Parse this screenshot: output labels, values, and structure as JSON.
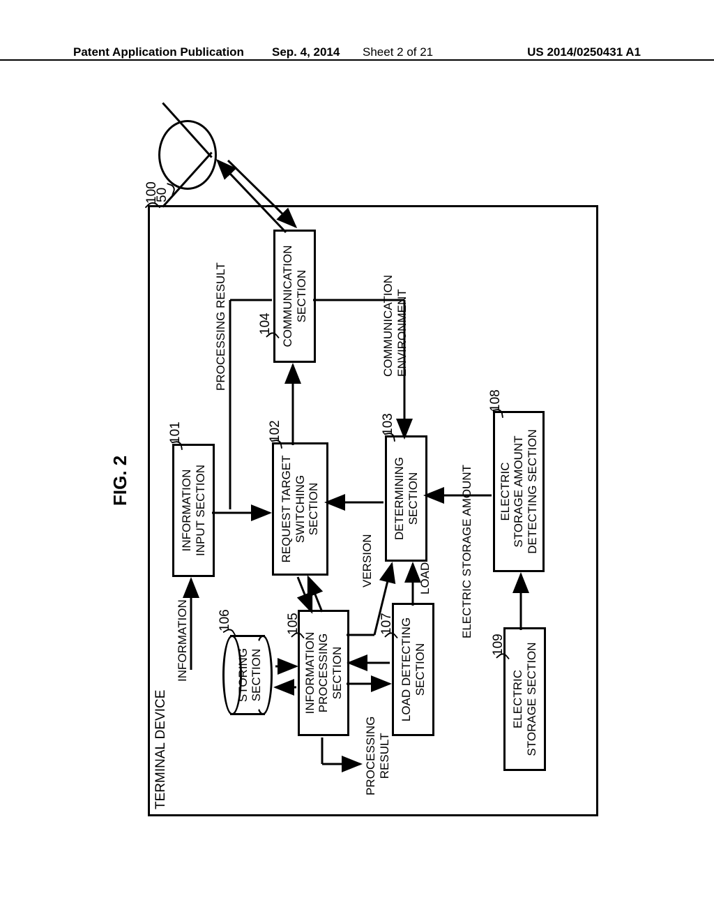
{
  "header": {
    "publication": "Patent Application Publication",
    "date": "Sep. 4, 2014",
    "sheet": "Sheet 2 of 21",
    "docnum": "US 2014/0250431 A1"
  },
  "figure_label": "FIG. 2",
  "device_title": "TERMINAL DEVICE",
  "refs": {
    "device": "100",
    "cloud": "50",
    "info_input": "101",
    "req_switch": "102",
    "determining": "103",
    "comm": "104",
    "info_proc": "105",
    "storing": "106",
    "load_detect": "107",
    "esa_detect": "108",
    "estorage": "109"
  },
  "labels": {
    "info_input": "INFORMATION\nINPUT SECTION",
    "req_switch": "REQUEST TARGET\nSWITCHING\nSECTION",
    "determining": "DETERMINING\nSECTION",
    "comm": "COMMUNICATION\nSECTION",
    "info_proc": "INFORMATION\nPROCESSING\nSECTION",
    "storing": "STORING\nSECTION",
    "load_detect": "LOAD DETECTING\nSECTION",
    "esa_detect": "ELECTRIC\nSTORAGE AMOUNT\nDETECTING SECTION",
    "estorage": "ELECTRIC\nSTORAGE SECTION"
  },
  "signals": {
    "information": "INFORMATION",
    "processing_result_left": "PROCESSING\nRESULT",
    "processing_result_top": "PROCESSING RESULT",
    "version": "VERSION",
    "load": "LOAD",
    "electric_storage_amount": "ELECTRIC STORAGE AMOUNT",
    "comm_env": "COMMUNICATION\nENVIRONMENT"
  }
}
